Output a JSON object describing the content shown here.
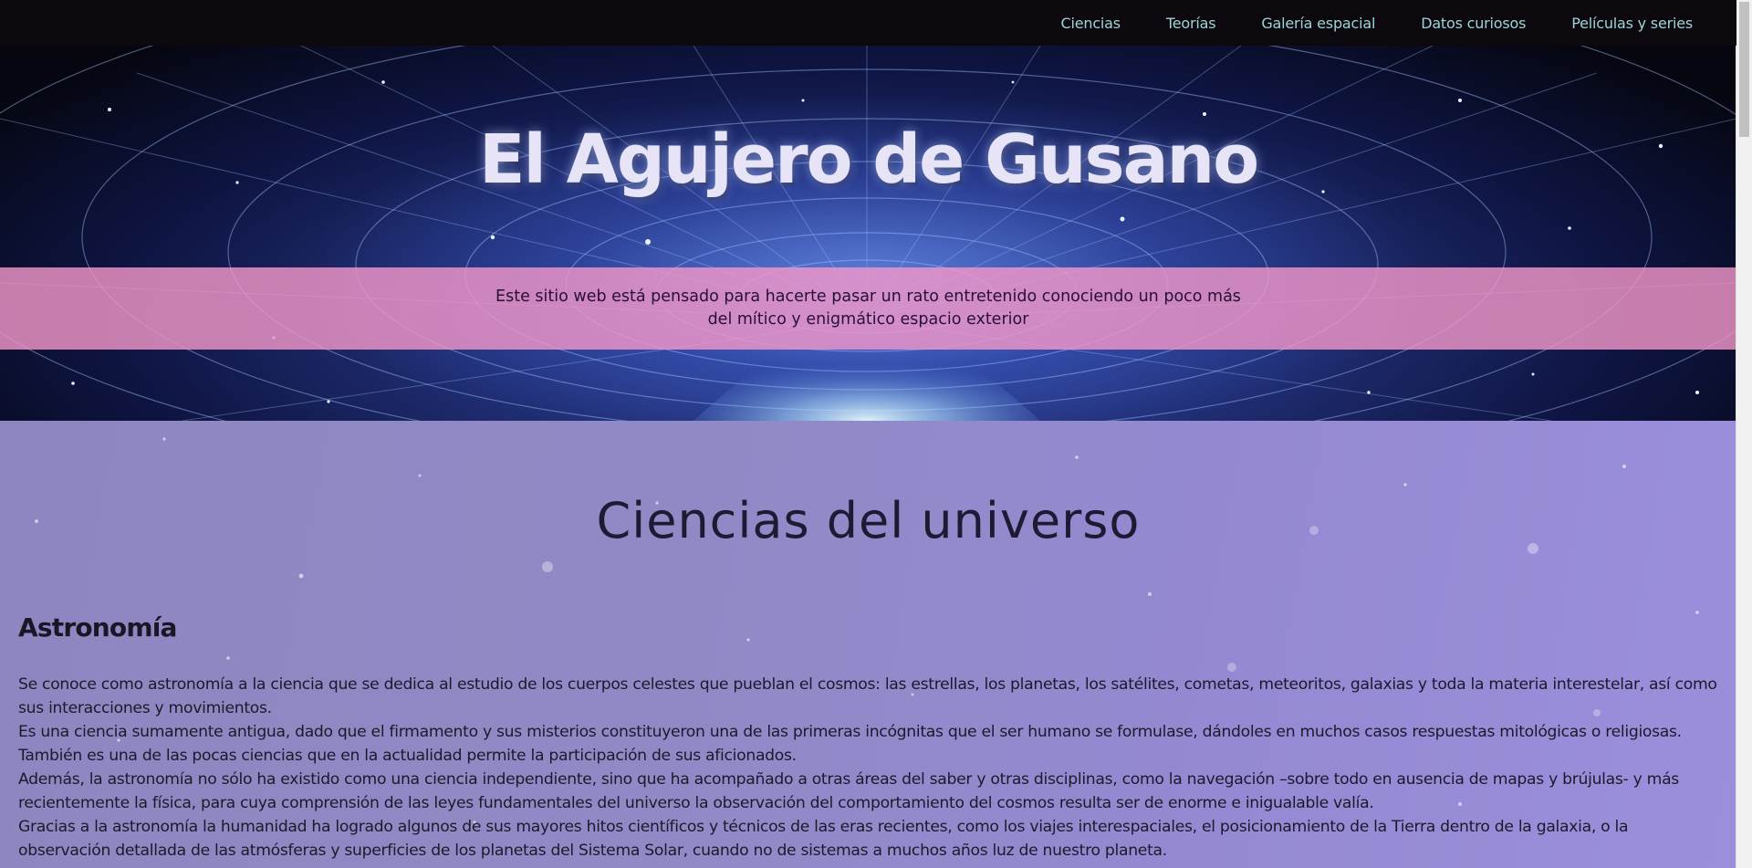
{
  "nav": {
    "items": [
      {
        "label": "Ciencias"
      },
      {
        "label": "Teorías"
      },
      {
        "label": "Galería espacial"
      },
      {
        "label": "Datos curiosos"
      },
      {
        "label": "Películas y series"
      }
    ]
  },
  "hero": {
    "title": "El Agujero de Gusano",
    "tagline": "Este sitio web está pensado para hacerte pasar un rato entretenido conociendo un poco más del mítico y enigmático espacio exterior"
  },
  "section": {
    "title": "Ciencias del universo",
    "subsection_title": "Astronomía",
    "paragraphs": [
      "Se conoce como astronomía a la ciencia que se dedica al estudio de los cuerpos celestes que pueblan el cosmos: las estrellas, los planetas, los satélites, cometas, meteoritos, galaxias y toda la materia interestelar, así como sus interacciones y movimientos.",
      "Es una ciencia sumamente antigua, dado que el firmamento y sus misterios constituyeron una de las primeras incógnitas que el ser humano se formulase, dándoles en muchos casos respuestas mitológicas o religiosas. También es una de las pocas ciencias que en la actualidad permite la participación de sus aficionados.",
      "Además, la astronomía no sólo ha existido como una ciencia independiente, sino que ha acompañado a otras áreas del saber y otras disciplinas, como la navegación –sobre todo en ausencia de mapas y brújulas- y más recientemente la física, para cuya comprensión de las leyes fundamentales del universo la observación del comportamiento del cosmos resulta ser de enorme e inigualable valía.",
      "Gracias a la astronomía la humanidad ha logrado algunos de sus mayores hitos científicos y técnicos de las eras recientes, como los viajes interespaciales, el posicionamiento de la Tierra dentro de la galaxia, o la observación detallada de las atmósferas y superficies de los planetas del Sistema Solar, cuando no de sistemas a muchos años luz de nuestro planeta."
    ]
  },
  "colors": {
    "nav_bg": "#0d080d",
    "nav_link": "#9ad6d6",
    "band": "#f096c8",
    "content_bg": "#9189c8"
  }
}
